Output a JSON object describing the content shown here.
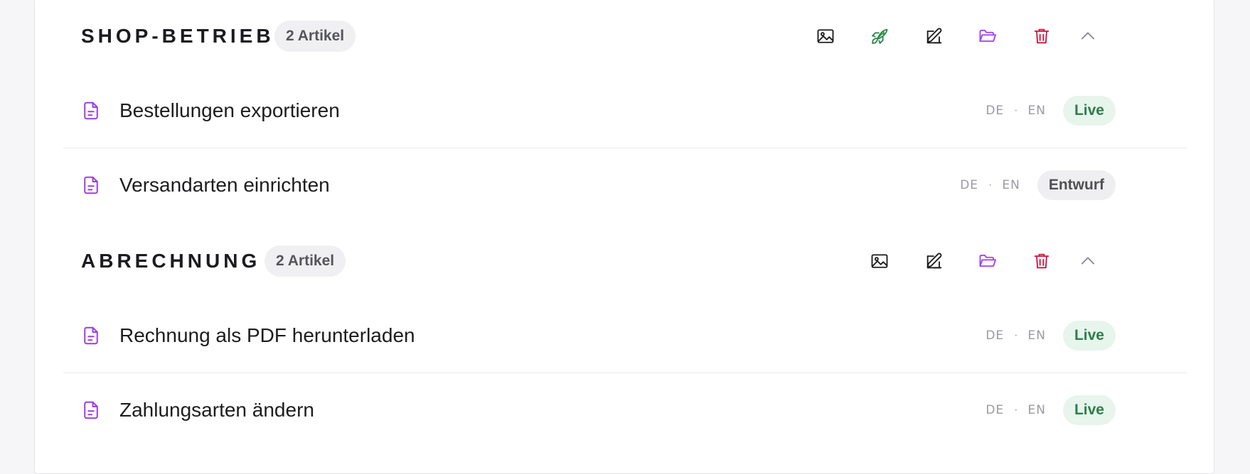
{
  "sections": [
    {
      "title": "SHOP-BETRIEB",
      "count": "2 Artikel",
      "articles": [
        {
          "title": "Bestellungen exportieren",
          "lang_de": "DE",
          "lang_en": "EN",
          "status": "Live"
        },
        {
          "title": "Versandarten einrichten",
          "lang_de": "DE",
          "lang_en": "EN",
          "status": "Entwurf"
        }
      ]
    },
    {
      "title": "ABRECHNUNG",
      "count": "2 Artikel",
      "articles": [
        {
          "title": "Rechnung als PDF herunterladen",
          "lang_de": "DE",
          "lang_en": "EN",
          "status": "Live"
        },
        {
          "title": "Zahlungsarten ändern",
          "lang_de": "DE",
          "lang_en": "EN",
          "status": "Live"
        }
      ]
    }
  ],
  "separator": "·",
  "colors": {
    "doc_icon": "#9b3fe0",
    "rocket_icon": "#2f8a4a",
    "folder_icon": "#a23ff0",
    "trash_icon": "#d0153e",
    "live_bg": "#e7f5ec",
    "live_text": "#2f7d4a",
    "draft_bg": "#efeff1"
  },
  "icons": {
    "section_actions_shop": [
      "image-icon",
      "rocket-icon",
      "edit-icon",
      "folder-icon",
      "trash-icon",
      "chevron-up-icon"
    ],
    "section_actions_billing": [
      "image-icon",
      "edit-icon",
      "folder-icon",
      "trash-icon",
      "chevron-up-icon"
    ],
    "article": "document-icon"
  }
}
